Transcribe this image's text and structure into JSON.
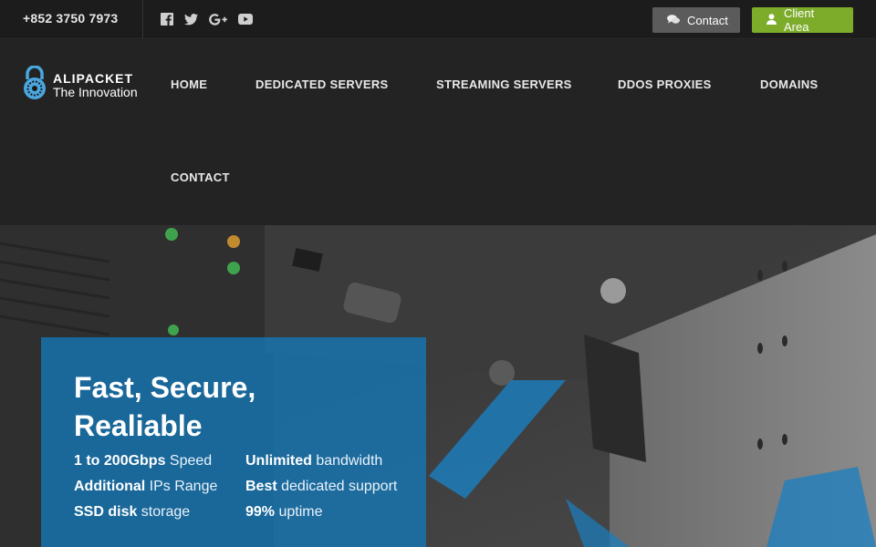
{
  "topbar": {
    "phone": "+852 3750 7973",
    "social": [
      "facebook-icon",
      "twitter-icon",
      "google-plus-icon",
      "youtube-icon"
    ],
    "contact_label": "Contact",
    "client_area_label": "Client Area"
  },
  "brand": {
    "name": "ALIPACKET",
    "tagline": "The Innovation"
  },
  "nav": {
    "items": [
      "HOME",
      "DEDICATED SERVERS",
      "STREAMING SERVERS",
      "DDOS PROXIES",
      "DOMAINS",
      "CONTACT"
    ]
  },
  "hero": {
    "title": "Fast, Secure, Realiable",
    "col1": [
      {
        "bold": "1 to 200Gbps",
        "rest": " Speed"
      },
      {
        "bold": "Additional",
        "rest": " IPs Range"
      },
      {
        "bold": "SSD disk",
        "rest": " storage"
      }
    ],
    "col2": [
      {
        "bold": "Unlimited",
        "rest": " bandwidth"
      },
      {
        "bold": "Best",
        "rest": " dedicated support"
      },
      {
        "bold": "99%",
        "rest": " uptime"
      }
    ]
  },
  "colors": {
    "accent_green": "#7cac2a",
    "card_blue": "#1478b9",
    "topbar_bg": "#1c1c1c",
    "header_bg": "#232323"
  }
}
